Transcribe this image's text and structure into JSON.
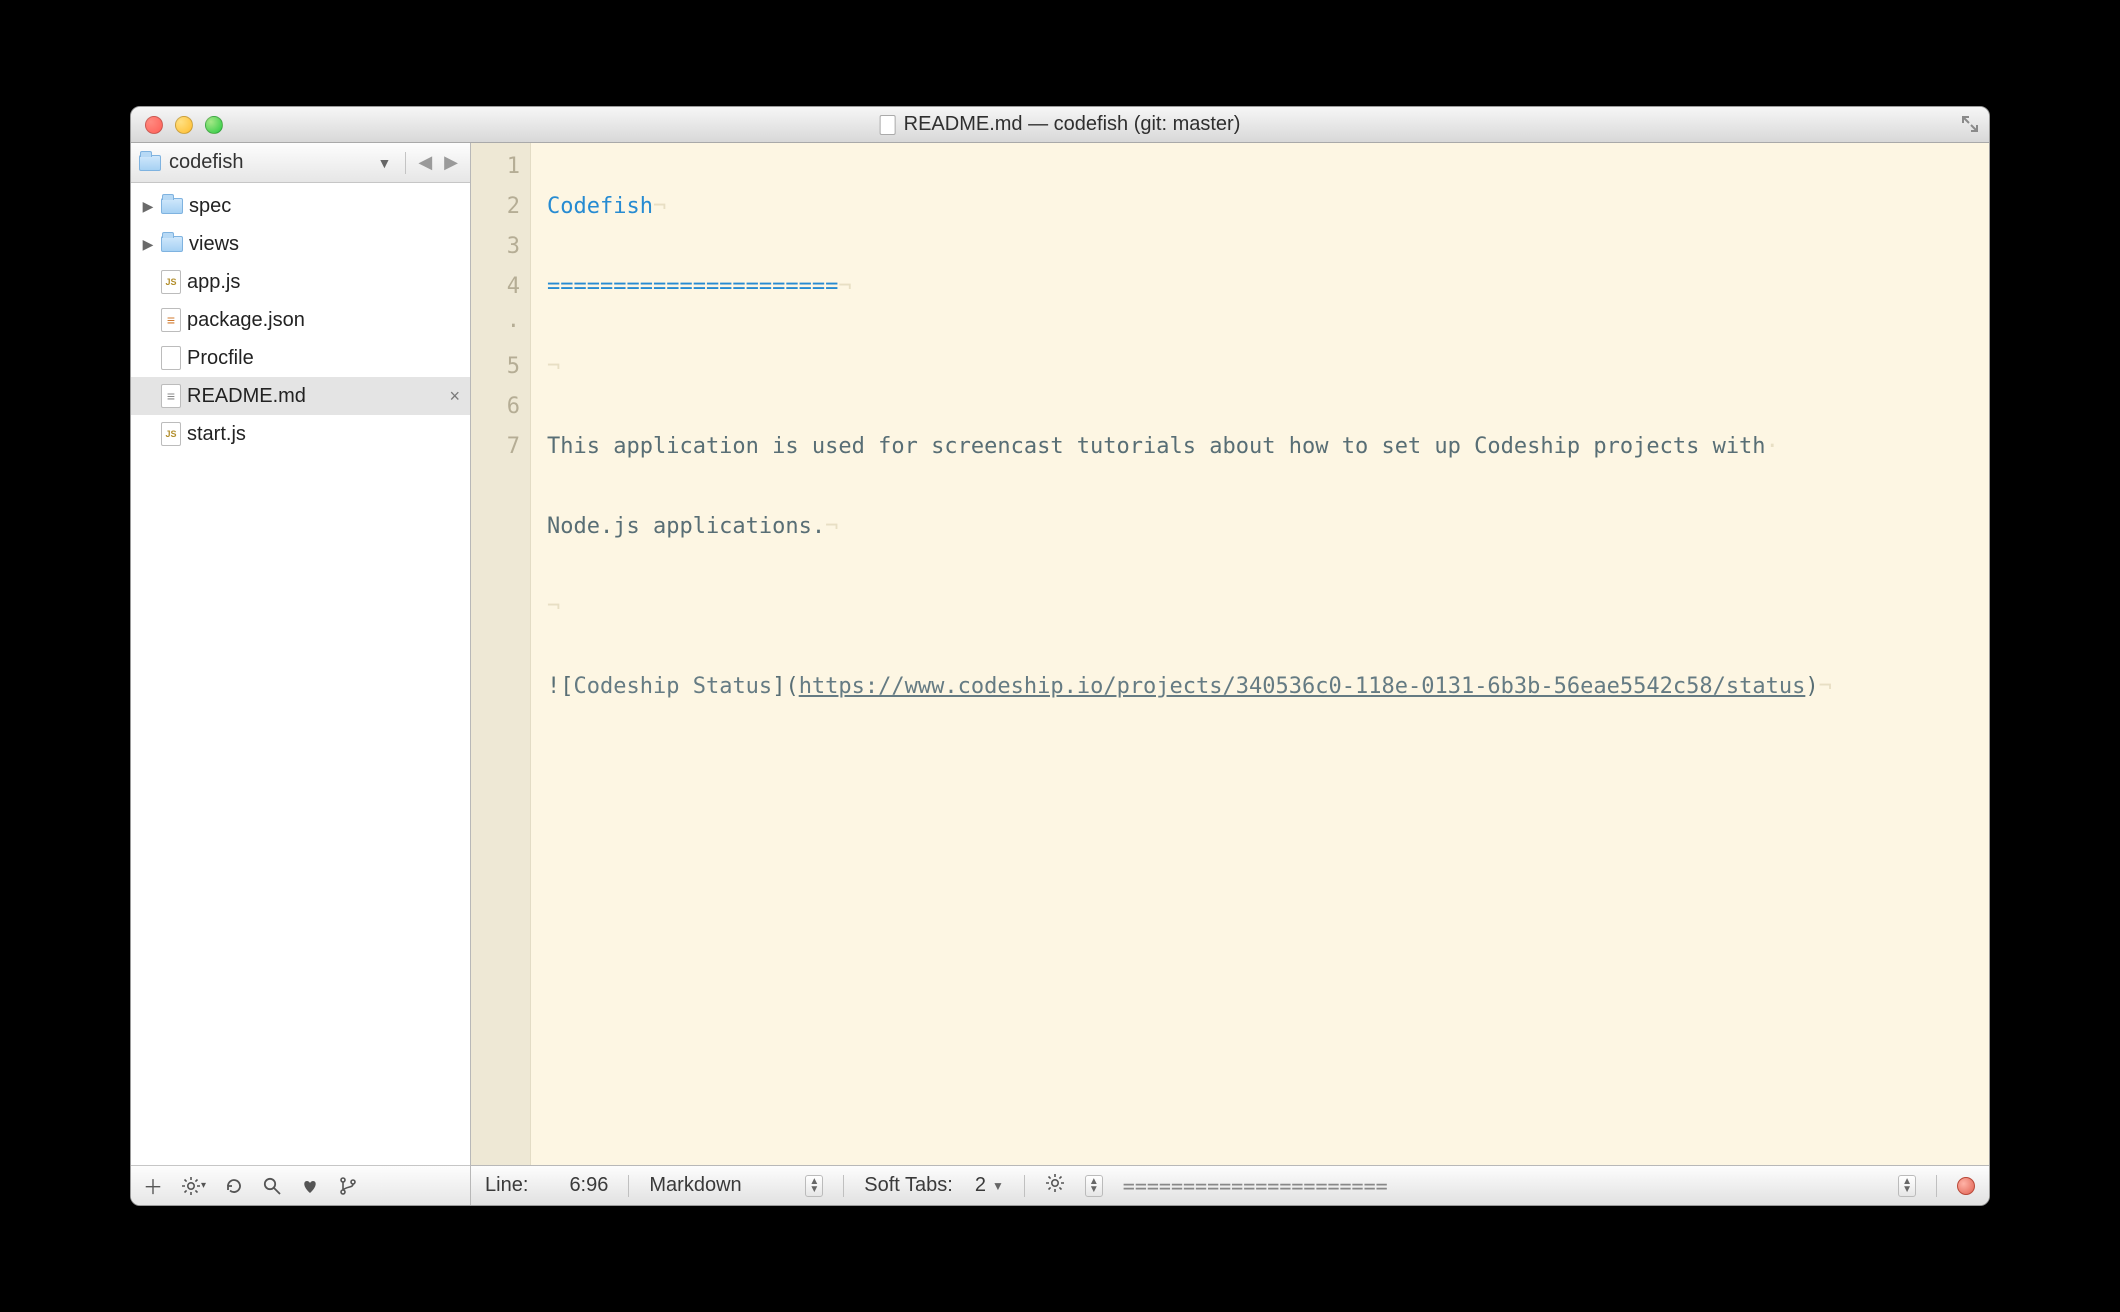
{
  "window": {
    "title": "README.md — codefish (git: master)"
  },
  "sidebar": {
    "project": "codefish",
    "items": [
      {
        "name": "spec",
        "type": "folder",
        "expandable": true,
        "selected": false
      },
      {
        "name": "views",
        "type": "folder",
        "expandable": true,
        "selected": false
      },
      {
        "name": "app.js",
        "type": "js",
        "expandable": false,
        "selected": false
      },
      {
        "name": "package.json",
        "type": "json",
        "expandable": false,
        "selected": false
      },
      {
        "name": "Procfile",
        "type": "plain",
        "expandable": false,
        "selected": false
      },
      {
        "name": "README.md",
        "type": "md",
        "expandable": false,
        "selected": true
      },
      {
        "name": "start.js",
        "type": "js",
        "expandable": false,
        "selected": false
      }
    ]
  },
  "editor": {
    "gutter": [
      "1",
      "2",
      "3",
      "4",
      "·",
      "5",
      "6",
      "7"
    ],
    "lines": {
      "l1_heading": "Codefish",
      "l2_underline": "======================",
      "l4_text_a": "This application is used for screencast tutorials about how to set up Codeship projects with",
      "l4_text_b": "Node.js applications.",
      "l6_bang": "!",
      "l6_lbr": "[",
      "l6_alt": "Codeship Status",
      "l6_rbr": "]",
      "l6_lpar": "(",
      "l6_url": "https://www.codeship.io/projects/340536c0-118e-0131-6b3b-56eae5542c58/status",
      "l6_rpar": ")"
    }
  },
  "status": {
    "line_label": "Line:",
    "line_value": "6:96",
    "language": "Markdown",
    "soft_tabs_label": "Soft Tabs:",
    "soft_tabs_value": "2",
    "symbols": "======================"
  }
}
